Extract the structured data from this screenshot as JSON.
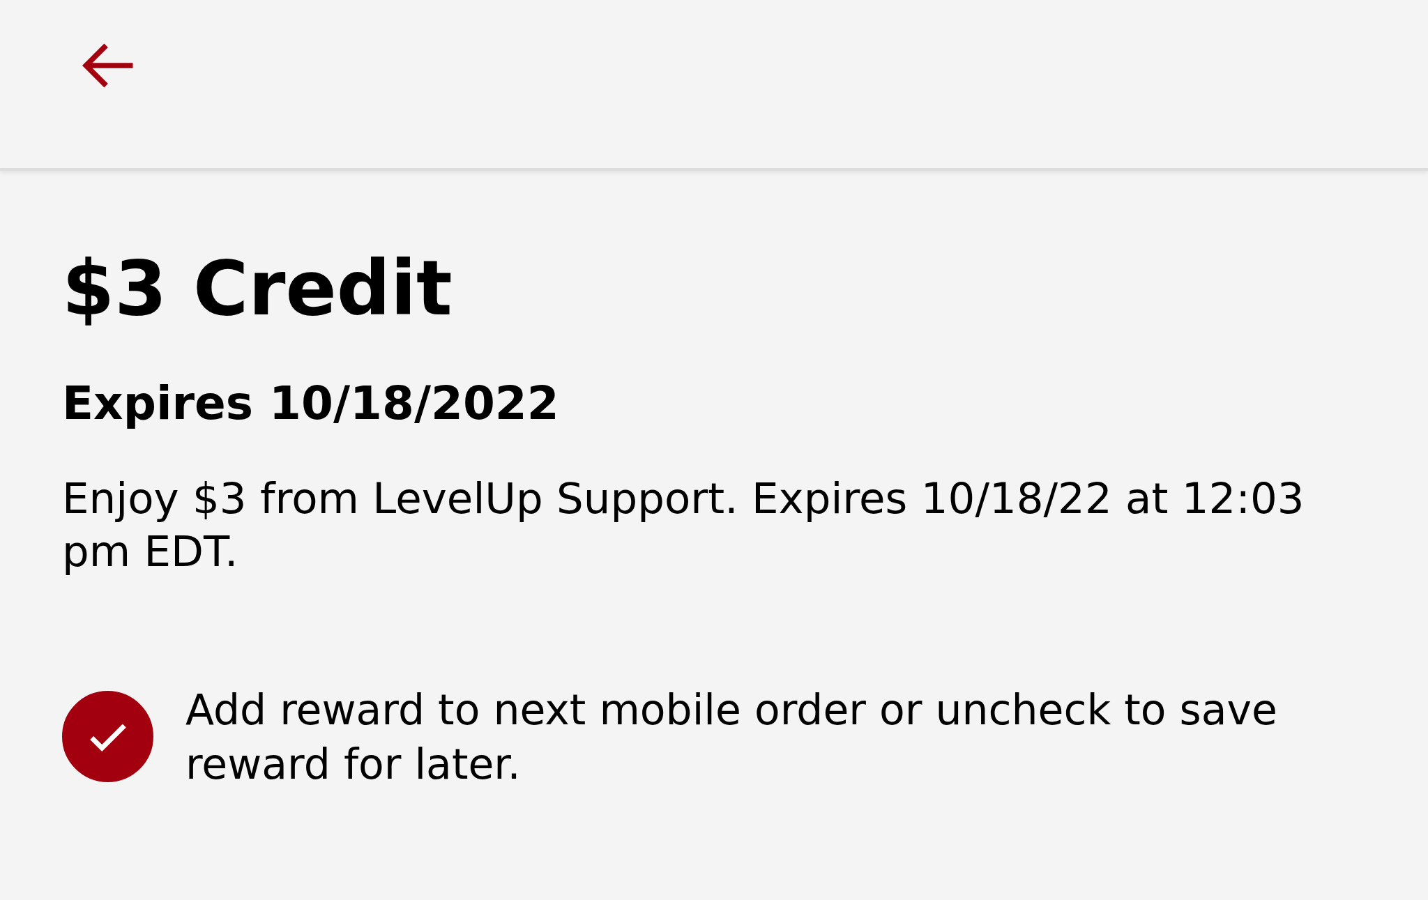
{
  "reward": {
    "title": "$3 Credit",
    "expiry": "Expires 10/18/2022",
    "description": "Enjoy $3 from LevelUp Support. Expires 10/18/22 at 12:03 pm EDT."
  },
  "option": {
    "label": "Add reward to next mobile order or uncheck to save reward for later.",
    "checked": true
  }
}
